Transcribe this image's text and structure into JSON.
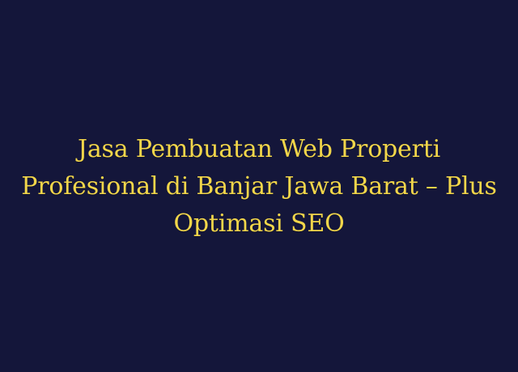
{
  "banner": {
    "title": "Jasa Pembuatan Web Properti Profesional di Banjar Jawa Barat – Plus Optimasi SEO",
    "background_color": "#14163a",
    "text_color": "#f2d64a"
  }
}
